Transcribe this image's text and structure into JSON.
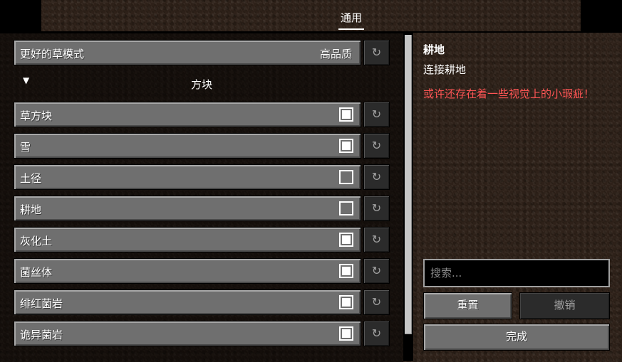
{
  "tabs": {
    "general": "通用"
  },
  "options": {
    "better_grass": {
      "label": "更好的草模式",
      "value": "高品质"
    },
    "section_blocks": "方块",
    "rows": [
      {
        "label": "草方块",
        "checked": true
      },
      {
        "label": "雪",
        "checked": true
      },
      {
        "label": "土径",
        "checked": false
      },
      {
        "label": "耕地",
        "checked": false
      },
      {
        "label": "灰化土",
        "checked": true
      },
      {
        "label": "菌丝体",
        "checked": true
      },
      {
        "label": "绯红菌岩",
        "checked": true
      },
      {
        "label": "诡异菌岩",
        "checked": true
      }
    ],
    "reset_icon": "↻"
  },
  "side": {
    "title": "耕地",
    "description": "连接耕地",
    "warning": "或许还存在着一些视觉上的小瑕疵！"
  },
  "search": {
    "placeholder": "搜索..."
  },
  "buttons": {
    "reset": "重置",
    "undo": "撤销",
    "done": "完成"
  },
  "colors": {
    "warning": "#ff5555",
    "button": "#6f6f6f",
    "button_disabled": "#2b2b2b"
  }
}
